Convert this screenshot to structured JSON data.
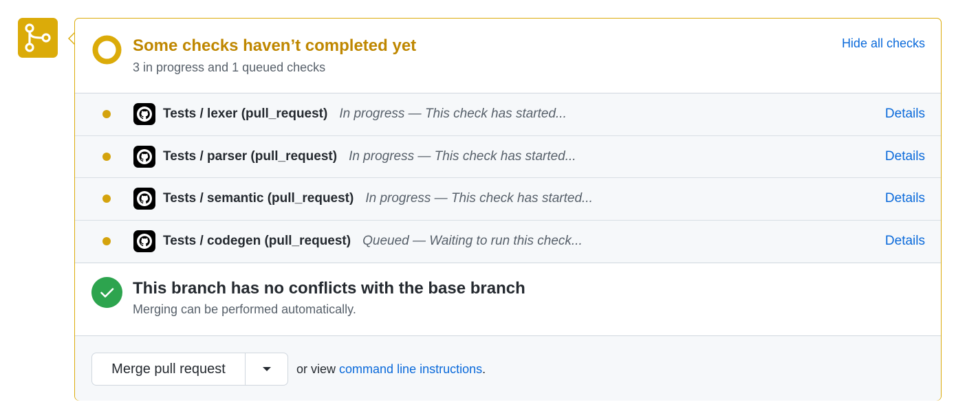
{
  "status": {
    "title": "Some checks haven’t completed yet",
    "subtitle": "3 in progress and 1 queued checks",
    "hide_link": "Hide all checks",
    "color": "#dbab09"
  },
  "checks": [
    {
      "name": "Tests / lexer (pull_request)",
      "description": "In progress — This check has started...",
      "details": "Details",
      "state": "in_progress",
      "icon": "github-logo-icon"
    },
    {
      "name": "Tests / parser (pull_request)",
      "description": "In progress — This check has started...",
      "details": "Details",
      "state": "in_progress",
      "icon": "github-logo-icon"
    },
    {
      "name": "Tests / semantic (pull_request)",
      "description": "In progress — This check has started...",
      "details": "Details",
      "state": "in_progress",
      "icon": "github-logo-icon"
    },
    {
      "name": "Tests / codegen (pull_request)",
      "description": "Queued — Waiting to run this check...",
      "details": "Details",
      "state": "queued",
      "icon": "github-logo-icon"
    }
  ],
  "conflict": {
    "title": "This branch has no conflicts with the base branch",
    "subtitle": "Merging can be performed automatically.",
    "color": "#2da44e"
  },
  "merge": {
    "button_label": "Merge pull request",
    "or_view": "or view",
    "cli_link": "command line instructions",
    "period": "."
  },
  "icons": {
    "badge": "git-merge-icon",
    "status": "pending-ring-icon",
    "conflict": "check-circle-icon",
    "dropdown": "caret-down-icon"
  }
}
